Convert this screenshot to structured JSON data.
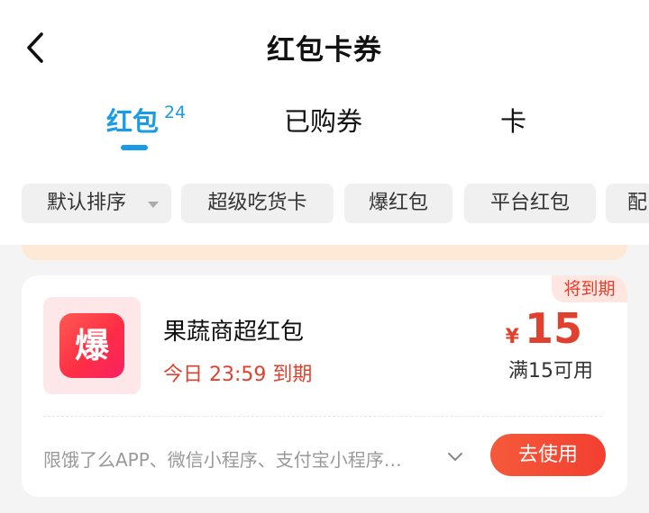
{
  "header": {
    "title": "红包卡券",
    "back_icon": "chevron-left-icon"
  },
  "tabs": [
    {
      "label": "红包",
      "count": "24",
      "active": true
    },
    {
      "label": "已购券",
      "active": false
    },
    {
      "label": "卡",
      "active": false
    }
  ],
  "filters": [
    {
      "label": "默认排序"
    },
    {
      "label": "超级吃货卡"
    },
    {
      "label": "爆红包"
    },
    {
      "label": "平台红包"
    },
    {
      "label": "配"
    }
  ],
  "coupon": {
    "badge": "将到期",
    "logo_text": "爆",
    "name": "果蔬商超红包",
    "expire": "今日 23:59 到期",
    "currency": "¥",
    "amount": "15",
    "threshold": "满15可用",
    "scope": "限饿了么APP、微信小程序、支付宝小程序…",
    "action": "去使用"
  },
  "colors": {
    "accent_blue": "#1a9be6",
    "accent_red": "#e2402e",
    "button_red": "#f34a34"
  }
}
